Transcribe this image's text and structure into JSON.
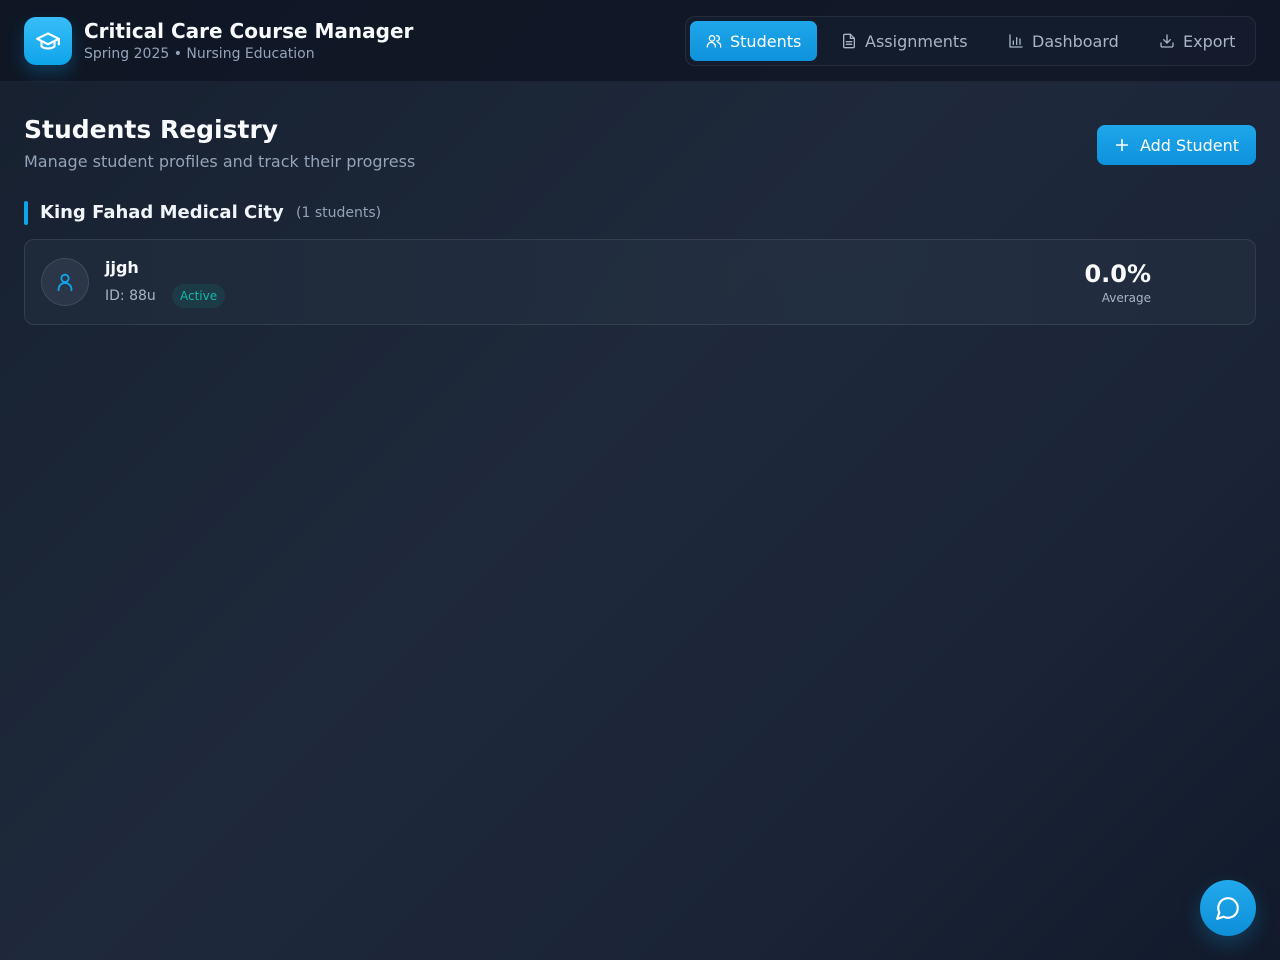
{
  "header": {
    "title": "Critical Care Course Manager",
    "subtitle": "Spring 2025 • Nursing Education",
    "logo_icon": "graduation-cap-icon"
  },
  "nav": {
    "tabs": [
      {
        "label": "Students",
        "icon": "users-icon",
        "active": true
      },
      {
        "label": "Assignments",
        "icon": "document-icon",
        "active": false
      },
      {
        "label": "Dashboard",
        "icon": "bar-chart-icon",
        "active": false
      },
      {
        "label": "Export",
        "icon": "download-icon",
        "active": false
      }
    ]
  },
  "page": {
    "title": "Students Registry",
    "subtitle": "Manage student profiles and track their progress",
    "add_button_label": "Add Student"
  },
  "groups": [
    {
      "name": "King Fahad Medical City",
      "count_label": "(1 students)",
      "students": [
        {
          "name": "jjgh",
          "id_label": "ID: 88u",
          "status": "Active",
          "average_value": "0.0%",
          "average_label": "Average"
        }
      ]
    }
  ],
  "colors": {
    "accent": "#0ea5e9",
    "status_active": "#14b8a6",
    "background": "#1e293b"
  },
  "chat_button_icon": "chat-bubble-icon"
}
